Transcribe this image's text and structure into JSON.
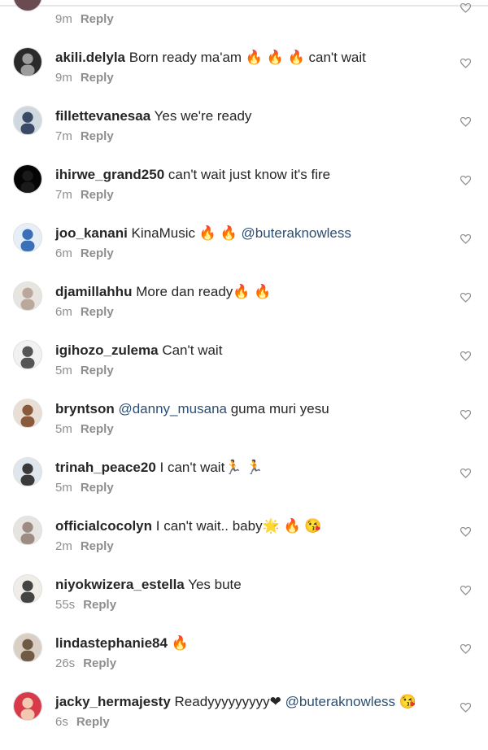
{
  "top_comment": {
    "time": "9m",
    "reply_label": "Reply"
  },
  "comments": [
    {
      "user": "akili.delyla",
      "text": "Born ready ma'am 🔥 🔥 🔥  can't wait",
      "mention": "",
      "tail": "",
      "time": "9m",
      "reply_label": "Reply"
    },
    {
      "user": "fillettevanesaa",
      "text": "Yes we're ready",
      "mention": "",
      "tail": "",
      "time": "7m",
      "reply_label": "Reply"
    },
    {
      "user": "ihirwe_grand250",
      "text": "can't wait just know it's fire",
      "mention": "",
      "tail": "",
      "time": "7m",
      "reply_label": "Reply"
    },
    {
      "user": "joo_kanani",
      "text": "KinaMusic 🔥 🔥",
      "mention": "@buteraknowless",
      "tail": "",
      "time": "6m",
      "reply_label": "Reply"
    },
    {
      "user": "djamillahhu",
      "text": "More dan ready🔥 🔥",
      "mention": "",
      "tail": "",
      "time": "6m",
      "reply_label": "Reply"
    },
    {
      "user": "igihozo_zulema",
      "text": "Can't wait",
      "mention": "",
      "tail": "",
      "time": "5m",
      "reply_label": "Reply"
    },
    {
      "user": "bryntson",
      "text": "",
      "mention": "@danny_musana",
      "tail": "guma muri yesu",
      "time": "5m",
      "reply_label": "Reply"
    },
    {
      "user": "trinah_peace20",
      "text": "I can't wait🏃 🏃",
      "mention": "",
      "tail": "",
      "time": "5m",
      "reply_label": "Reply"
    },
    {
      "user": "officialcocolyn",
      "text": "I can't wait.. baby🌟 🔥 😘",
      "mention": "",
      "tail": "",
      "time": "2m",
      "reply_label": "Reply"
    },
    {
      "user": "niyokwizera_estella",
      "text": "Yes bute",
      "mention": "",
      "tail": "",
      "time": "55s",
      "reply_label": "Reply"
    },
    {
      "user": "lindastephanie84",
      "text": "🔥",
      "mention": "",
      "tail": "",
      "time": "26s",
      "reply_label": "Reply"
    },
    {
      "user": "jacky_hermajesty",
      "text": "Readyyyyyyyyy❤",
      "mention": "@buteraknowless",
      "tail": "😘",
      "time": "6s",
      "reply_label": "Reply"
    }
  ],
  "colors": {
    "text": "#262626",
    "meta": "#8e8e8e",
    "mention": "#2b4f74",
    "background": "#ffffff"
  },
  "icons": {
    "like": "heart-outline-icon"
  }
}
